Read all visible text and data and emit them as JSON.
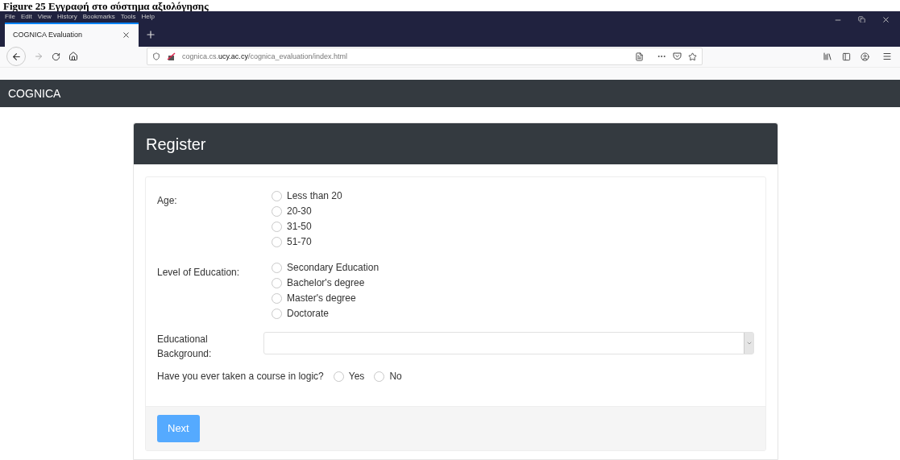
{
  "caption": "Figure 25 Εγγραφή στο σύστημα αξιολόγησης",
  "menu": [
    "File",
    "Edit",
    "View",
    "History",
    "Bookmarks",
    "Tools",
    "Help"
  ],
  "tabs": [
    {
      "label": "COGNICA Evaluation",
      "selected": true
    }
  ],
  "url": {
    "host_pre": "cognica.cs.",
    "host_main": "ucy.ac.cy",
    "path": "/cognica_evaluation/index.html"
  },
  "navbar": {
    "brand": "COGNICA"
  },
  "card": {
    "title": "Register",
    "fields": [
      {
        "kind": "radios",
        "label": "Age:",
        "options": [
          {
            "label": "Less than 20",
            "selected": false
          },
          {
            "label": "20-30",
            "selected": false
          },
          {
            "label": "31-50",
            "selected": false
          },
          {
            "label": "51-70",
            "selected": false
          }
        ]
      },
      {
        "kind": "radios",
        "label": "Level of Education:",
        "options": [
          {
            "label": "Secondary Education",
            "selected": false
          },
          {
            "label": "Bachelor's degree",
            "selected": false
          },
          {
            "label": "Master's degree",
            "selected": false
          },
          {
            "label": "Doctorate",
            "selected": false
          }
        ]
      },
      {
        "kind": "select",
        "label": "Educational Background:"
      },
      {
        "kind": "inline",
        "label": "Have you ever taken a course in logic?",
        "options": [
          {
            "label": "Yes",
            "selected": false
          },
          {
            "label": "No",
            "selected": false
          }
        ]
      }
    ],
    "button": "Next"
  }
}
